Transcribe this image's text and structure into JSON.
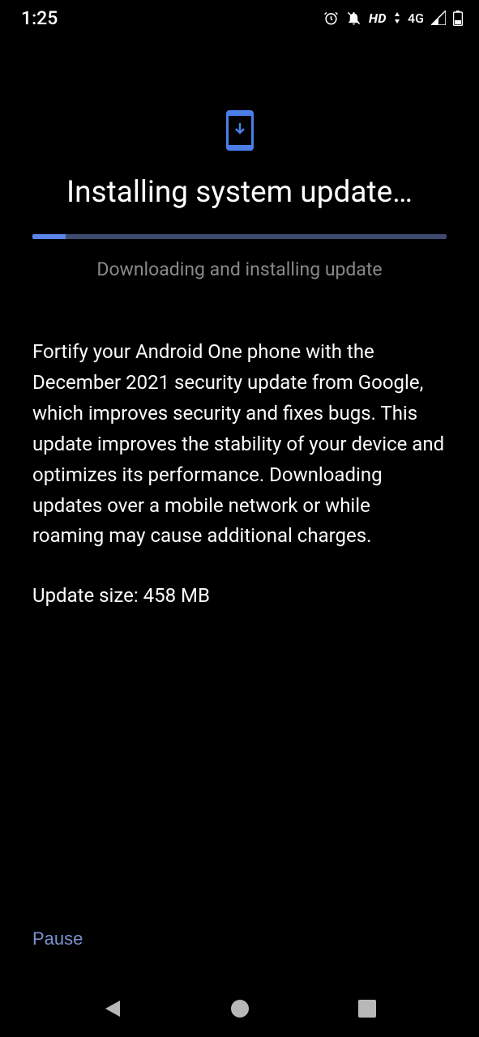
{
  "statusbar": {
    "time": "1:25",
    "hd_label": "HD",
    "network_label": "4G"
  },
  "icon": "phone-download-icon",
  "title": "Installing system update…",
  "progress": {
    "percent": 8,
    "status": "Downloading and installing update"
  },
  "description": "Fortify your Android One phone with the December 2021 security update from Google, which improves security and fixes bugs. This update improves the stability of your device and optimizes its performance. Downloading updates over a mobile network or while roaming may cause additional charges.",
  "update_size_label": "Update size: 458 MB",
  "pause_label": "Pause",
  "colors": {
    "accent": "#4c7ee8",
    "background": "#000000"
  }
}
